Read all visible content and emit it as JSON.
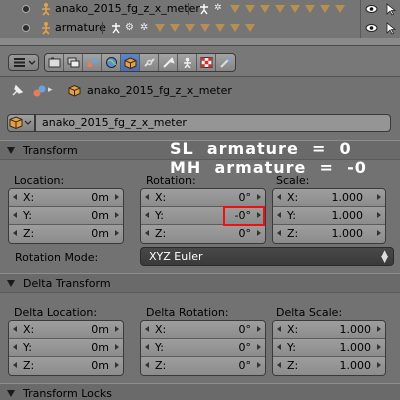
{
  "outliner": {
    "rows": [
      {
        "name": "anako_2015_fg_z_x_meter"
      },
      {
        "name": "armature"
      }
    ]
  },
  "path": {
    "object_name": "anako_2015_fg_z_x_meter"
  },
  "object_field": {
    "value": "anako_2015_fg_z_x_meter"
  },
  "overlay": {
    "line1": "SL  armature  =  0",
    "line2": "MH  armature  =  -0"
  },
  "transform": {
    "title": "Transform",
    "location_label": "Location:",
    "rotation_label": "Rotation:",
    "scale_label": "Scale:",
    "location": [
      {
        "axis": "X:",
        "value": "0m"
      },
      {
        "axis": "Y:",
        "value": "0m"
      },
      {
        "axis": "Z:",
        "value": "0m"
      }
    ],
    "rotation": [
      {
        "axis": "X:",
        "value": "0°"
      },
      {
        "axis": "Y:",
        "value": "-0°"
      },
      {
        "axis": "Z:",
        "value": "0°"
      }
    ],
    "scale": [
      {
        "axis": "X:",
        "value": "1.000"
      },
      {
        "axis": "Y:",
        "value": "1.000"
      },
      {
        "axis": "Z:",
        "value": "1.000"
      }
    ],
    "rotation_mode_label": "Rotation Mode:",
    "rotation_mode_value": "XYZ Euler"
  },
  "delta_transform": {
    "title": "Delta Transform",
    "location_label": "Delta Location:",
    "rotation_label": "Delta Rotation:",
    "scale_label": "Delta Scale:",
    "location": [
      {
        "axis": "X:",
        "value": "0m"
      },
      {
        "axis": "Y:",
        "value": "0m"
      },
      {
        "axis": "Z:",
        "value": "0m"
      }
    ],
    "rotation": [
      {
        "axis": "X:",
        "value": "0°"
      },
      {
        "axis": "Y:",
        "value": "0°"
      },
      {
        "axis": "Z:",
        "value": "0°"
      }
    ],
    "scale": [
      {
        "axis": "X:",
        "value": "1.000"
      },
      {
        "axis": "Y:",
        "value": "1.000"
      },
      {
        "axis": "Z:",
        "value": "1.000"
      }
    ]
  },
  "transform_locks": {
    "title": "Transform Locks"
  },
  "colors": {
    "active_tab": "#5a7ec0",
    "highlight": "#ee1111",
    "object_orange": "#e2a24a"
  }
}
